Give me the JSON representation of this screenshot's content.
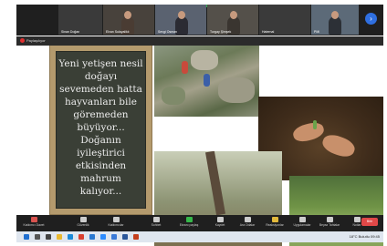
{
  "participants": [
    {
      "header": "",
      "name": "Sinan Doğan"
    },
    {
      "header": "",
      "name": "Elvan Sulayaliklı"
    },
    {
      "header": "",
      "name": "Sevgi Osman"
    },
    {
      "header": "",
      "name": "Turgay Şimşek"
    },
    {
      "header": "",
      "name": "Haternal"
    },
    {
      "header": "",
      "name": "PMI"
    }
  ],
  "share_bar": {
    "label": "Paylaşılıyor"
  },
  "slide": {
    "poem_lines": [
      "Yeni yetişen nesil",
      "doğayı",
      "sevemeden hatta",
      "hayvanları bile",
      "göremeden",
      "büyüyor...",
      "Doğanın",
      "iyileştirici",
      "etkisinden",
      "mahrum",
      "kalıyor..."
    ]
  },
  "controls": [
    {
      "label": "Katılımcı Davet",
      "icon": "person-add-icon",
      "color": "#d9534f"
    },
    {
      "label": "Güvenlik",
      "icon": "shield-icon",
      "color": "#cccccc"
    },
    {
      "label": "Katılımcılar",
      "icon": "people-icon",
      "color": "#cccccc"
    },
    {
      "label": "Sohbet",
      "icon": "chat-icon",
      "color": "#cccccc"
    },
    {
      "label": "Ekranı paylaş",
      "icon": "share-screen-icon",
      "color": "#35b84a"
    },
    {
      "label": "Kaydet",
      "icon": "record-icon",
      "color": "#cccccc"
    },
    {
      "label": "Ara Odalar",
      "icon": "breakout-rooms-icon",
      "color": "#cccccc"
    },
    {
      "label": "Reaksiyonlar",
      "icon": "reactions-icon",
      "color": "#e2b93b"
    },
    {
      "label": "Uygulamalar",
      "icon": "apps-icon",
      "color": "#cccccc"
    },
    {
      "label": "Beyaz Tahtalar",
      "icon": "whiteboard-icon",
      "color": "#cccccc"
    },
    {
      "label": "Notlar",
      "icon": "notes-icon",
      "color": "#cccccc"
    }
  ],
  "end_button": {
    "label": "Bitir"
  },
  "taskbar": {
    "icons": [
      "start-icon",
      "search-icon",
      "task-view-icon",
      "explorer-icon",
      "edge-icon",
      "chrome-icon",
      "mail-icon",
      "zoom-icon",
      "store-icon",
      "word-icon",
      "powerpoint-icon"
    ],
    "tray_text": "18°C Bulutlu",
    "clock": "09:45"
  }
}
